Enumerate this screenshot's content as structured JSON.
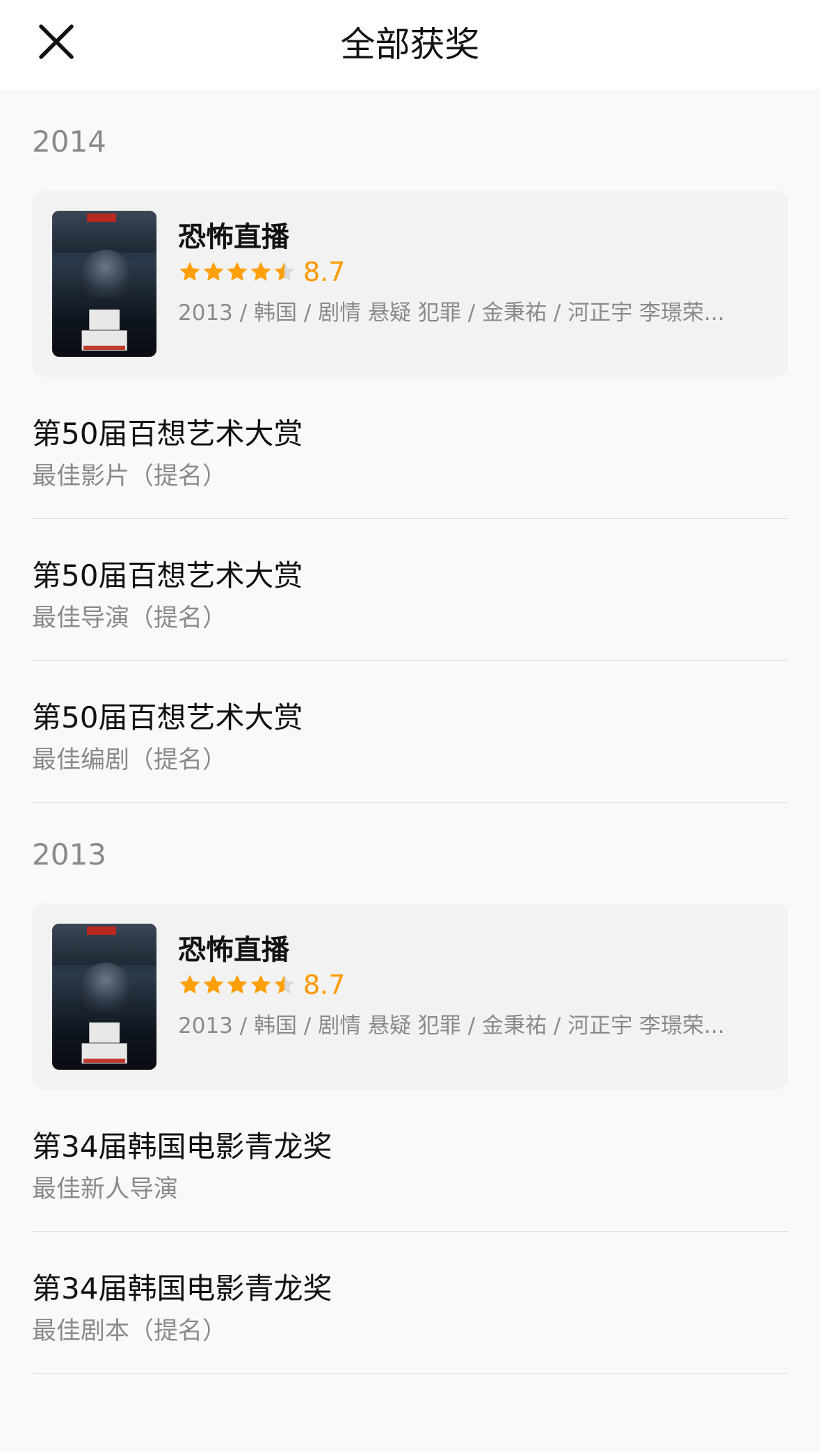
{
  "header": {
    "title": "全部获奖",
    "close_icon": "close-icon"
  },
  "groups": [
    {
      "year": "2014",
      "movie": {
        "title": "恐怖直播",
        "rating": "8.7",
        "stars": 4.5,
        "info": "2013 / 韩国 / 剧情 悬疑 犯罪 / 金秉祐 / 河正宇 李璟荣..."
      },
      "awards": [
        {
          "name": "第50届百想艺术大赏",
          "category": "最佳影片（提名）"
        },
        {
          "name": "第50届百想艺术大赏",
          "category": "最佳导演（提名）"
        },
        {
          "name": "第50届百想艺术大赏",
          "category": "最佳编剧（提名）"
        }
      ]
    },
    {
      "year": "2013",
      "movie": {
        "title": "恐怖直播",
        "rating": "8.7",
        "stars": 4.5,
        "info": "2013 / 韩国 / 剧情 悬疑 犯罪 / 金秉祐 / 河正宇 李璟荣..."
      },
      "awards": [
        {
          "name": "第34届韩国电影青龙奖",
          "category": "最佳新人导演"
        },
        {
          "name": "第34届韩国电影青龙奖",
          "category": "最佳剧本（提名）"
        }
      ]
    }
  ],
  "colors": {
    "star": "#ff9f0a",
    "star_empty": "#d9d9d9",
    "rating_text": "#ff9900"
  }
}
